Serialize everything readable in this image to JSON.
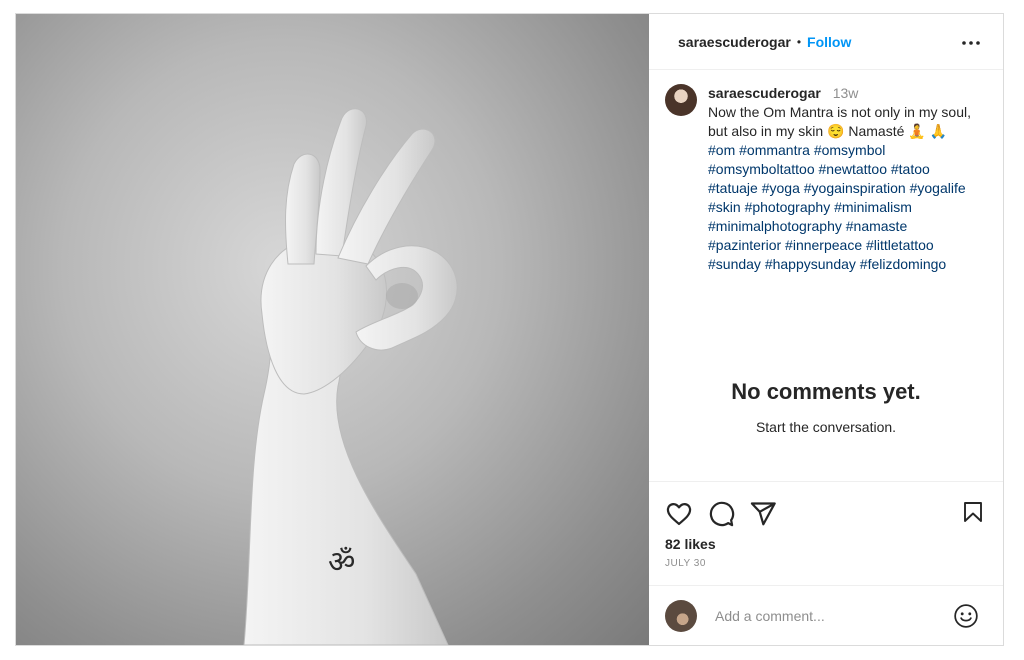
{
  "post": {
    "username": "saraescuderogar",
    "separator": "•",
    "follow_label": "Follow",
    "more_icon": "more-horizontal-icon",
    "caption": {
      "username": "saraescuderogar",
      "time": "13w",
      "text": "Now the Om Mantra is not only in my soul, but also in my skin 😌 Namasté 🧘 🙏",
      "hashtags": "#om #ommantra #omsymbol #omsymboltattoo #newtattoo #tatoo #tatuaje #yoga #yogainspiration #yogalife #skin #photography #minimalism #minimalphotography #namaste #pazinterior #innerpeace #littletattoo #sunday #happysunday #felizdomingo"
    },
    "empty_state": {
      "title": "No comments yet.",
      "subtitle": "Start the conversation."
    },
    "likes": "82 likes",
    "date": "JULY 30",
    "comment_placeholder": "Add a comment...",
    "tattoo_glyph": "ॐ"
  },
  "colors": {
    "follow": "#0095f6",
    "hashtag": "#00376b",
    "border": "#dbdbdb"
  }
}
